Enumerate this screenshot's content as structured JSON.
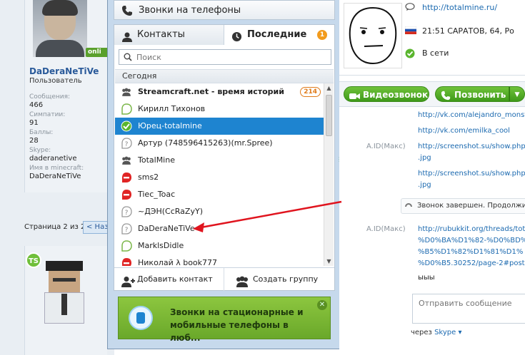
{
  "forum": {
    "user1": {
      "username": "DaDeraNeTiVe",
      "role": "Пользователь",
      "online_badge": "onli",
      "stats": [
        {
          "key": "Сообщения:",
          "value": "466"
        },
        {
          "key": "Симпатии:",
          "value": "91"
        },
        {
          "key": "Баллы:",
          "value": "28"
        },
        {
          "key": "Skype:",
          "value": "daderanetive"
        },
        {
          "key": "Имя в minecraft:",
          "value": "DaDeraNeTiVe"
        }
      ]
    },
    "pager": {
      "text": "Страница 2 из 2",
      "prev_label": "< Наз"
    },
    "user2": {
      "badge": "TS"
    }
  },
  "skype": {
    "calls_bar": {
      "label": "Звонки на телефоны",
      "icon": "phone-icon"
    },
    "tabs": {
      "contacts": "Контакты",
      "recent": "Последние",
      "recent_badge": "1"
    },
    "search": {
      "placeholder": "Поиск"
    },
    "section": "Сегодня",
    "list": [
      {
        "name": "Streamcraft.net - время историй",
        "icon": "group-icon",
        "bold": true,
        "count": "214"
      },
      {
        "name": "Кирилл Тихонов",
        "icon": "status-offline-icon"
      },
      {
        "name": "Юрец-totalmine",
        "icon": "status-online-icon",
        "selected": true
      },
      {
        "name": "Артур (748596415263)(mr.Spree)",
        "icon": "status-unknown-icon"
      },
      {
        "name": "TotalMine",
        "icon": "group-icon"
      },
      {
        "name": "sms2",
        "icon": "status-dnd-icon"
      },
      {
        "name": "Tiec_Toac",
        "icon": "status-dnd-icon"
      },
      {
        "name": "~ДЭН(CcRaZyY)",
        "icon": "status-unknown-icon"
      },
      {
        "name": "DaDeraNeTiVe",
        "icon": "status-unknown-icon"
      },
      {
        "name": "MarklsDidle",
        "icon": "status-offline-icon"
      },
      {
        "name": "Николай λ book777",
        "icon": "status-dnd-icon"
      }
    ],
    "actions": {
      "add_contact": "Добавить контакт",
      "create_group": "Создать группу"
    },
    "promo": {
      "text": "Звонки на стационарные и мобильные телефоны в люб..."
    },
    "profile": {
      "url": "http://totalmine.ru/",
      "location": "21:51 САРАТОВ, 64, Ро",
      "status": "В сети"
    },
    "callbar": {
      "video": "Видеозвонок",
      "call": "Позвонить"
    },
    "chat": {
      "sender": "A.ID(Макс)",
      "links1": [
        "http://vk.com/alejandro_monst",
        "http://vk.com/emilka_cool"
      ],
      "links2": [
        "http://screenshot.su/show.php",
        ".jpg",
        "http://screenshot.su/show.php",
        ".jpg"
      ],
      "callend": "Звонок завершен. Продолжит",
      "links3": [
        "http://rubukkit.org/threads/tota",
        "%D0%BA%D1%82-%D0%BD%",
        "%B5%D1%82%D1%81%D1%",
        "%D0%B5.30252/page-2#post-"
      ],
      "plain": "ыыы"
    },
    "compose": {
      "placeholder": "Отправить сообщение"
    },
    "via": {
      "prefix": "через",
      "service": "Skype ▾"
    }
  },
  "colors": {
    "skype_blue": "#1e84d0",
    "green_button": "#3f9a1a",
    "window_frame": "#c6d9ec",
    "annotation_arrow": "#e0141e"
  }
}
